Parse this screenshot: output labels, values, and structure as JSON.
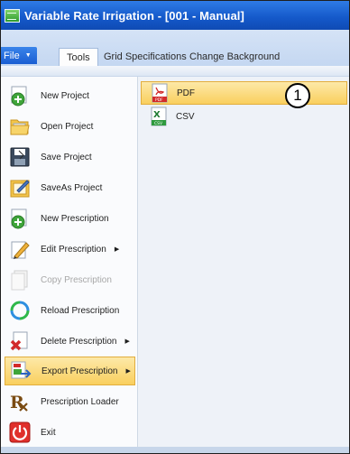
{
  "window": {
    "title": "Variable Rate Irrigation - [001 - Manual]"
  },
  "tabs": {
    "file": "File",
    "tools": "Tools",
    "grid_specifications": "Grid Specifications",
    "change_background": "Change Background"
  },
  "file_menu": {
    "items": [
      {
        "label": "New Project",
        "icon": "new-project-icon"
      },
      {
        "label": "Open Project",
        "icon": "open-folder-icon"
      },
      {
        "label": "Save Project",
        "icon": "save-icon"
      },
      {
        "label": "SaveAs Project",
        "icon": "save-as-icon"
      },
      {
        "label": "New Prescription",
        "icon": "new-prescription-icon"
      },
      {
        "label": "Edit Prescription",
        "icon": "edit-icon",
        "has_submenu": true
      },
      {
        "label": "Copy Prescription",
        "icon": "copy-icon",
        "disabled": true
      },
      {
        "label": "Reload Prescription",
        "icon": "reload-icon"
      },
      {
        "label": "Delete Prescription",
        "icon": "delete-icon",
        "has_submenu": true
      },
      {
        "label": "Export Prescription",
        "icon": "export-icon",
        "has_submenu": true,
        "selected": true
      },
      {
        "label": "Prescription Loader",
        "icon": "rx-icon"
      },
      {
        "label": "Exit",
        "icon": "power-icon"
      }
    ]
  },
  "export_submenu": {
    "items": [
      {
        "label": "PDF",
        "icon": "pdf-icon",
        "selected": true
      },
      {
        "label": "CSV",
        "icon": "csv-icon"
      }
    ]
  },
  "callout": {
    "label": "1"
  },
  "colors": {
    "title_bar": "#1458c9",
    "highlight": "#f9cf5e",
    "file_tab": "#1a5ed2"
  }
}
